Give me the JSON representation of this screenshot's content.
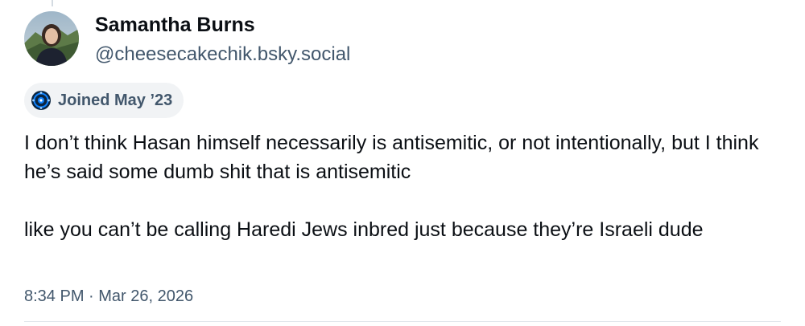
{
  "author": {
    "name": "Samantha Burns",
    "handle": "@cheesecakechik.bsky.social",
    "avatar_icon": "user-avatar"
  },
  "badge": {
    "icon": "bluesky-join-icon",
    "label": "Joined May ’23"
  },
  "post": {
    "paragraphs": [
      "I don’t think Hasan himself necessarily is antisemitic, or not intentionally, but I think he’s said some dumb shit that is antisemitic",
      "like you can’t be calling Haredi Jews inbred just because they’re Israeli dude"
    ]
  },
  "timestamp": "8:34 PM · Mar 26, 2026",
  "colors": {
    "text_primary": "#0b0f14",
    "text_secondary": "#42576c",
    "badge_bg": "#f1f3f5",
    "accent": "#1083fe"
  }
}
